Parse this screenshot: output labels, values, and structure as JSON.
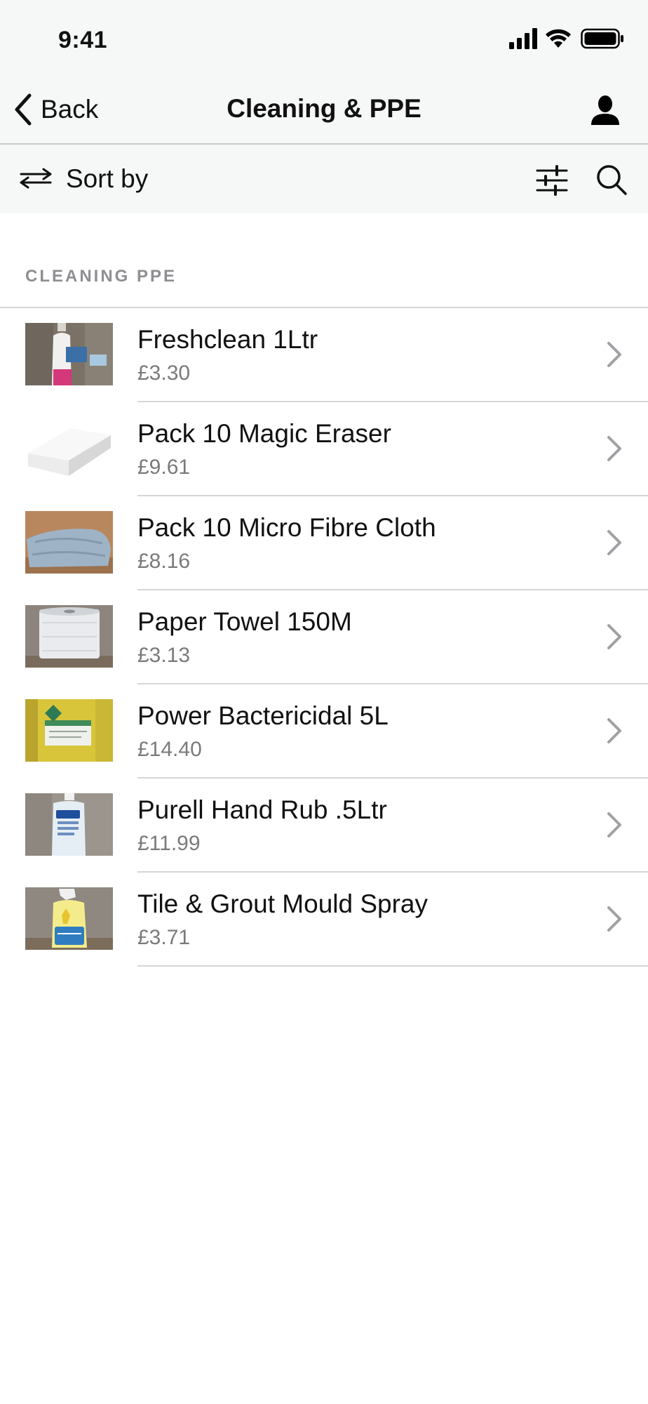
{
  "status_bar": {
    "time": "9:41"
  },
  "nav": {
    "back_label": "Back",
    "title": "Cleaning & PPE",
    "profile_icon": "person-icon"
  },
  "toolbar": {
    "sort_label": "Sort by",
    "sort_icon": "swap-arrows-icon",
    "filter_icon": "sliders-icon",
    "search_icon": "search-icon"
  },
  "section": {
    "header": "CLEANING PPE"
  },
  "products": [
    {
      "name": "Freshclean 1Ltr",
      "price": "£3.30",
      "thumb": "bottle-spray"
    },
    {
      "name": "Pack 10 Magic Eraser",
      "price": "£9.61",
      "thumb": "white-sponge"
    },
    {
      "name": "Pack 10 Micro Fibre Cloth",
      "price": "£8.16",
      "thumb": "blue-cloth"
    },
    {
      "name": "Paper Towel 150M",
      "price": "£3.13",
      "thumb": "paper-roll"
    },
    {
      "name": "Power Bactericidal 5L",
      "price": "£14.40",
      "thumb": "yellow-jug"
    },
    {
      "name": "Purell Hand Rub .5Ltr",
      "price": "£11.99",
      "thumb": "pump-bottle"
    },
    {
      "name": "Tile & Grout Mould Spray",
      "price": "£3.71",
      "thumb": "trigger-spray"
    }
  ],
  "colors": {
    "bar_background": "#f6f7f7",
    "separator": "#d6d6d6",
    "secondary_text": "#7a7a7a",
    "chevron": "#a0a0a5"
  }
}
